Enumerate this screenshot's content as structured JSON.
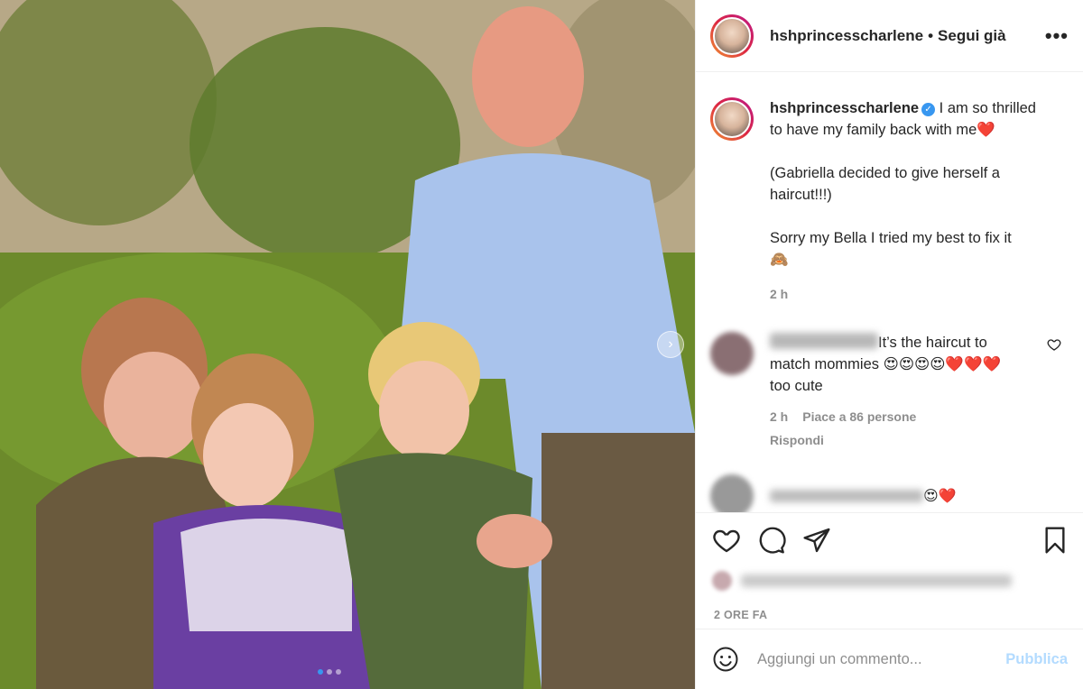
{
  "post": {
    "username": "hshprincesscharlene",
    "separator": "•",
    "follow_status": "Segui già",
    "more": "•••"
  },
  "caption": {
    "username": "hshprincesscharlene",
    "verified_glyph": "✓",
    "line1": "I am so thrilled to have my family back with me",
    "line1_emoji": "❤️",
    "line2": "(Gabriella decided to give herself a haircut!!!)",
    "line3": "Sorry my Bella I tried my best to fix it",
    "line3_emoji": "🙈",
    "time": "2 h"
  },
  "comments": [
    {
      "text": "It’s the haircut to match mommies",
      "emoji": "😍😍😍😍❤️❤️❤️",
      "text2": "too cute",
      "time": "2 h",
      "likes": "Piace a 86 persone",
      "reply": "Rispondi"
    },
    {
      "emoji": "😍❤️"
    }
  ],
  "footer": {
    "posted_ago": "2 ORE FA",
    "comment_placeholder": "Aggiungi un commento...",
    "publish_label": "Pubblica"
  },
  "icons": {
    "like": "heart-icon",
    "comment": "comment-icon",
    "share": "share-icon",
    "save": "bookmark-icon",
    "emoji": "emoji-icon",
    "next": "chevron-right-icon"
  },
  "carousel": {
    "slide_count": 3,
    "active_index": 0,
    "next_glyph": "›"
  },
  "colors": {
    "link": "#3897f0",
    "muted": "#8e8e8e",
    "publish_disabled": "#b3dbff"
  }
}
